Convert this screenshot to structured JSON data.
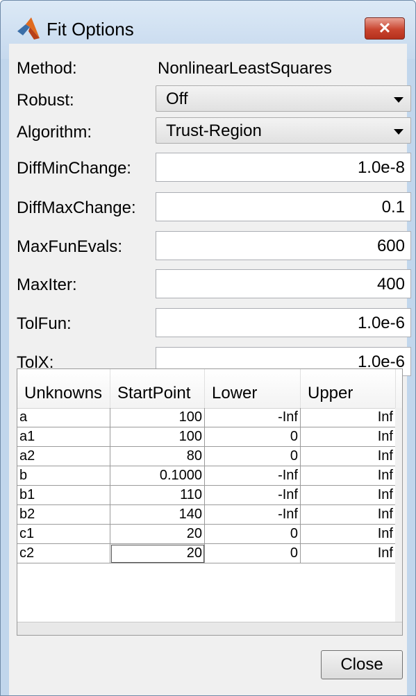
{
  "window": {
    "title": "Fit Options",
    "close_glyph": "✕"
  },
  "form": {
    "method_label": "Method:",
    "method_value": "NonlinearLeastSquares",
    "robust_label": "Robust:",
    "robust_value": "Off",
    "algorithm_label": "Algorithm:",
    "algorithm_value": "Trust-Region",
    "fields": [
      {
        "label": "DiffMinChange:",
        "value": "1.0e-8"
      },
      {
        "label": "DiffMaxChange:",
        "value": "0.1"
      },
      {
        "label": "MaxFunEvals:",
        "value": "600"
      },
      {
        "label": "MaxIter:",
        "value": "400"
      },
      {
        "label": "TolFun:",
        "value": "1.0e-6"
      },
      {
        "label": "TolX:",
        "value": "1.0e-6"
      }
    ]
  },
  "table": {
    "headers": [
      "Unknowns",
      "StartPoint",
      "Lower",
      "Upper"
    ],
    "rows": [
      [
        "a",
        "100",
        "-Inf",
        "Inf"
      ],
      [
        "a1",
        "100",
        "0",
        "Inf"
      ],
      [
        "a2",
        "80",
        "0",
        "Inf"
      ],
      [
        "b",
        "0.1000",
        "-Inf",
        "Inf"
      ],
      [
        "b1",
        "110",
        "-Inf",
        "Inf"
      ],
      [
        "b2",
        "140",
        "-Inf",
        "Inf"
      ],
      [
        "c1",
        "20",
        "0",
        "Inf"
      ],
      [
        "c2",
        "20",
        "0",
        "Inf"
      ]
    ]
  },
  "footer": {
    "close_label": "Close"
  },
  "icons": {
    "app": "matlab-icon",
    "dropdown": "chevron-down-icon"
  }
}
